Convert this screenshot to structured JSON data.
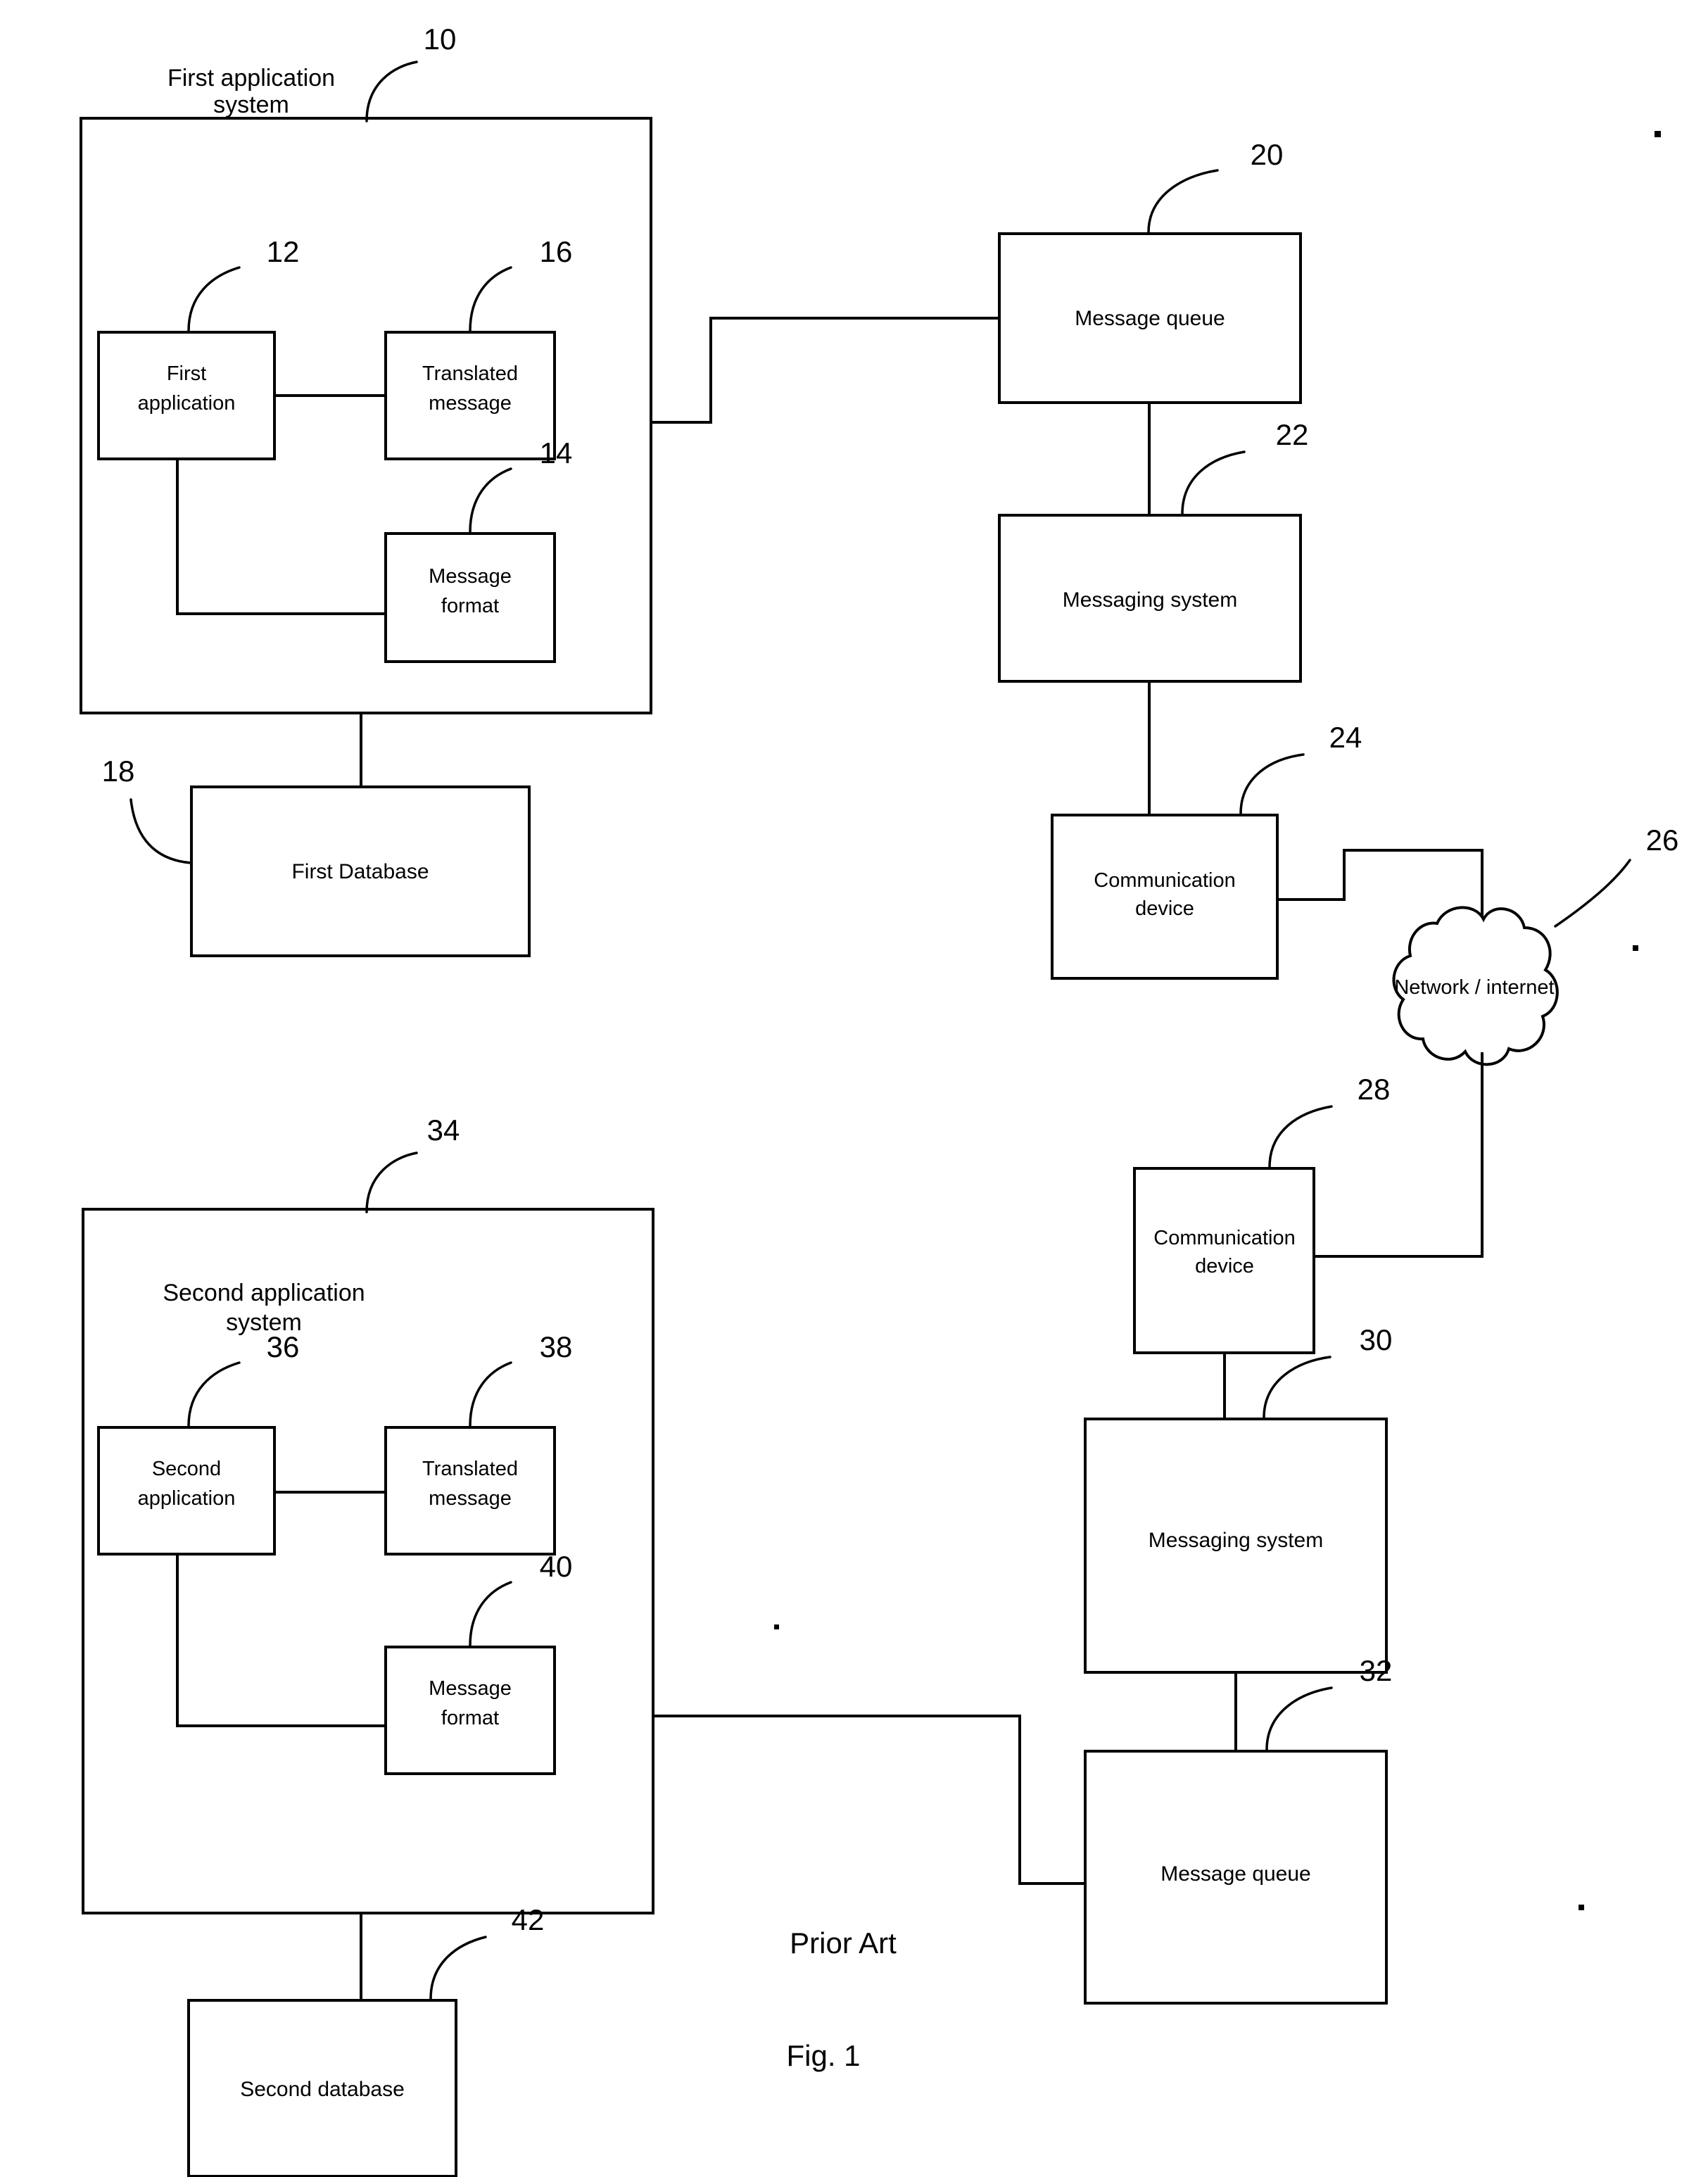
{
  "figure": {
    "caption_prior_art": "Prior Art",
    "caption_figure": "Fig. 1"
  },
  "systems": {
    "first": {
      "title_line1": "First application",
      "title_line2": "system",
      "ref": "10"
    },
    "second": {
      "title_line1": "Second application",
      "title_line2": "system",
      "ref": "34"
    }
  },
  "blocks": {
    "first_application": {
      "line1": "First",
      "line2": "application",
      "ref": "12"
    },
    "translated_message_1": {
      "line1": "Translated",
      "line2": "message",
      "ref": "16"
    },
    "message_format_1": {
      "line1": "Message",
      "line2": "format",
      "ref": "14"
    },
    "first_database": {
      "line1": "First Database",
      "ref": "18"
    },
    "message_queue_1": {
      "line1": "Message queue",
      "ref": "20"
    },
    "messaging_system_1": {
      "line1": "Messaging system",
      "ref": "22"
    },
    "communication_device_1": {
      "line1": "Communication",
      "line2": "device",
      "ref": "24"
    },
    "network_cloud": {
      "line1": "Network / internet",
      "ref": "26"
    },
    "communication_device_2": {
      "line1": "Communication",
      "line2": "device",
      "ref": "28"
    },
    "messaging_system_2": {
      "line1": "Messaging system",
      "ref": "30"
    },
    "message_queue_2": {
      "line1": "Message queue",
      "ref": "32"
    },
    "second_application": {
      "line1": "Second",
      "line2": "application",
      "ref": "36"
    },
    "translated_message_2": {
      "line1": "Translated",
      "line2": "message",
      "ref": "38"
    },
    "message_format_2": {
      "line1": "Message",
      "line2": "format",
      "ref": "40"
    },
    "second_database": {
      "line1": "Second database",
      "ref": "42"
    }
  },
  "colors": {
    "stroke": "#000000",
    "background": "#ffffff"
  }
}
